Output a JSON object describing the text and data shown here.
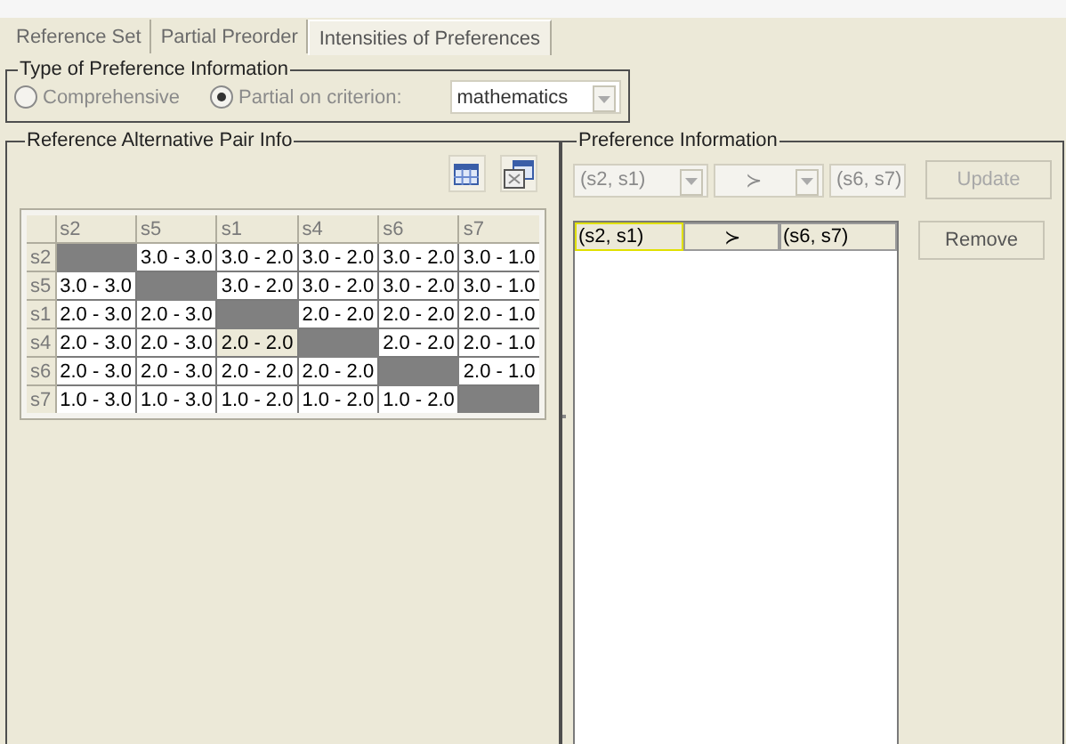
{
  "tabs": [
    {
      "label": "Reference Set",
      "selected": false
    },
    {
      "label": "Partial Preorder",
      "selected": false
    },
    {
      "label": "Intensities of Preferences",
      "selected": true
    }
  ],
  "preference_type": {
    "title": "Type of Preference Information",
    "disabled": true,
    "options": [
      {
        "label": "Comprehensive",
        "selected": false
      },
      {
        "label": "Partial on criterion:",
        "selected": true
      }
    ],
    "criterion": "mathematics"
  },
  "pair_info": {
    "title": "Reference Alternative Pair Info",
    "columns": [
      "s2",
      "s5",
      "s1",
      "s4",
      "s6",
      "s7"
    ],
    "rows": [
      {
        "header": "s2",
        "cells": [
          {
            "kind": "diagonal"
          },
          {
            "kind": "value",
            "text": "3.0 - 3.0",
            "selected": false
          },
          {
            "kind": "value",
            "text": "3.0 - 2.0",
            "selected": false
          },
          {
            "kind": "value",
            "text": "3.0 - 2.0",
            "selected": false
          },
          {
            "kind": "value",
            "text": "3.0 - 2.0",
            "selected": false
          },
          {
            "kind": "value",
            "text": "3.0 - 1.0",
            "selected": false
          }
        ]
      },
      {
        "header": "s5",
        "cells": [
          {
            "kind": "value",
            "text": "3.0 - 3.0",
            "selected": false
          },
          {
            "kind": "diagonal"
          },
          {
            "kind": "value",
            "text": "3.0 - 2.0",
            "selected": false
          },
          {
            "kind": "value",
            "text": "3.0 - 2.0",
            "selected": false
          },
          {
            "kind": "value",
            "text": "3.0 - 2.0",
            "selected": false
          },
          {
            "kind": "value",
            "text": "3.0 - 1.0",
            "selected": false
          }
        ]
      },
      {
        "header": "s1",
        "cells": [
          {
            "kind": "value",
            "text": "2.0 - 3.0",
            "selected": false
          },
          {
            "kind": "value",
            "text": "2.0 - 3.0",
            "selected": false
          },
          {
            "kind": "diagonal"
          },
          {
            "kind": "value",
            "text": "2.0 - 2.0",
            "selected": false
          },
          {
            "kind": "value",
            "text": "2.0 - 2.0",
            "selected": false
          },
          {
            "kind": "value",
            "text": "2.0 - 1.0",
            "selected": false
          }
        ]
      },
      {
        "header": "s4",
        "cells": [
          {
            "kind": "value",
            "text": "2.0 - 3.0",
            "selected": false
          },
          {
            "kind": "value",
            "text": "2.0 - 3.0",
            "selected": false
          },
          {
            "kind": "value",
            "text": "2.0 - 2.0",
            "selected": true
          },
          {
            "kind": "diagonal"
          },
          {
            "kind": "value",
            "text": "2.0 - 2.0",
            "selected": false
          },
          {
            "kind": "value",
            "text": "2.0 - 1.0",
            "selected": false
          }
        ]
      },
      {
        "header": "s6",
        "cells": [
          {
            "kind": "value",
            "text": "2.0 - 3.0",
            "selected": false
          },
          {
            "kind": "value",
            "text": "2.0 - 3.0",
            "selected": false
          },
          {
            "kind": "value",
            "text": "2.0 - 2.0",
            "selected": false
          },
          {
            "kind": "value",
            "text": "2.0 - 2.0",
            "selected": false
          },
          {
            "kind": "diagonal"
          },
          {
            "kind": "value",
            "text": "2.0 - 1.0",
            "selected": false
          }
        ]
      },
      {
        "header": "s7",
        "cells": [
          {
            "kind": "value",
            "text": "1.0 - 3.0",
            "selected": false
          },
          {
            "kind": "value",
            "text": "1.0 - 3.0",
            "selected": false
          },
          {
            "kind": "value",
            "text": "1.0 - 2.0",
            "selected": false
          },
          {
            "kind": "value",
            "text": "1.0 - 2.0",
            "selected": false
          },
          {
            "kind": "value",
            "text": "1.0 - 2.0",
            "selected": false
          },
          {
            "kind": "diagonal"
          }
        ]
      }
    ]
  },
  "preference_info": {
    "title": "Preference Information",
    "editor": {
      "left": "(s2, s1)",
      "relation": "≻",
      "right": "(s6, s7)",
      "disabled": true
    },
    "update_button": {
      "label": "Update",
      "disabled": true
    },
    "remove_button": {
      "label": "Remove",
      "disabled": false
    },
    "entries": [
      {
        "left": "(s2, s1)",
        "relation": "≻",
        "right": "(s6, s7)",
        "focused": true
      }
    ]
  }
}
